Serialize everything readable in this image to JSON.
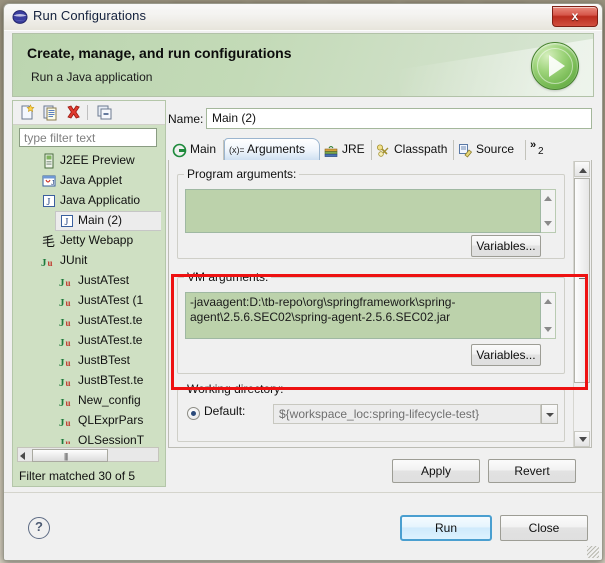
{
  "window": {
    "title": "Run Configurations",
    "title_icon": "eclipse-globe-icon",
    "close_label": "x"
  },
  "banner": {
    "title": "Create, manage, and run configurations",
    "subtitle": "Run a Java application",
    "badge_icon": "run-play-icon"
  },
  "sidebar": {
    "toolbar": [
      {
        "name": "new-configuration-icon",
        "label": "New launch configuration"
      },
      {
        "name": "duplicate-configuration-icon",
        "label": "Duplicate"
      },
      {
        "name": "delete-configuration-icon",
        "label": "Delete"
      },
      {
        "name": "collapse-all-icon",
        "label": "Collapse All"
      }
    ],
    "filter_placeholder": "type filter text",
    "filter_value": "",
    "tree": [
      {
        "label": "J2EE Preview",
        "icon": "j2ee-preview-icon",
        "indent": 1,
        "selected": false
      },
      {
        "label": "Java Applet",
        "icon": "java-applet-icon",
        "indent": 1,
        "selected": false
      },
      {
        "label": "Java Applicatio",
        "icon": "java-application-icon",
        "indent": 1,
        "selected": false
      },
      {
        "label": "Main (2)",
        "icon": "java-application-icon",
        "indent": 2,
        "selected": true
      },
      {
        "label": "Jetty Webapp",
        "icon": "jetty-webapp-icon",
        "indent": 1,
        "selected": false
      },
      {
        "label": "JUnit",
        "icon": "junit-icon",
        "indent": 1,
        "selected": false
      },
      {
        "label": "JustATest",
        "icon": "junit-icon",
        "indent": 2,
        "selected": false
      },
      {
        "label": "JustATest (1",
        "icon": "junit-icon",
        "indent": 2,
        "selected": false
      },
      {
        "label": "JustATest.te",
        "icon": "junit-icon",
        "indent": 2,
        "selected": false
      },
      {
        "label": "JustATest.te",
        "icon": "junit-icon",
        "indent": 2,
        "selected": false
      },
      {
        "label": "JustBTest",
        "icon": "junit-icon",
        "indent": 2,
        "selected": false
      },
      {
        "label": "JustBTest.te",
        "icon": "junit-icon",
        "indent": 2,
        "selected": false
      },
      {
        "label": "New_config",
        "icon": "junit-icon",
        "indent": 2,
        "selected": false
      },
      {
        "label": "QLExprPars",
        "icon": "junit-icon",
        "indent": 2,
        "selected": false
      },
      {
        "label": "QLSessionT",
        "icon": "junit-icon",
        "indent": 2,
        "selected": false
      }
    ],
    "filter_status": "Filter matched 30 of 5"
  },
  "main": {
    "name_label": "Name:",
    "name_value": "Main (2)",
    "tabs": [
      {
        "label": "Main",
        "icon": "main-tab-icon",
        "active": false
      },
      {
        "label": "Arguments",
        "icon": "arguments-tab-icon",
        "active": true
      },
      {
        "label": "JRE",
        "icon": "jre-tab-icon",
        "active": false
      },
      {
        "label": "Classpath",
        "icon": "classpath-tab-icon",
        "active": false
      },
      {
        "label": "Source",
        "icon": "source-tab-icon",
        "active": false
      }
    ],
    "tab_overflow_label": "2",
    "program_arguments": {
      "legend": "Program arguments:",
      "value": "",
      "variables_button": "Variables..."
    },
    "vm_arguments": {
      "legend": "VM arguments:",
      "value": "-javaagent:D:\\tb-repo\\org\\springframework\\spring-agent\\2.5.6.SEC02\\spring-agent-2.5.6.SEC02.jar",
      "variables_button": "Variables..."
    },
    "working_directory": {
      "legend": "Working directory:",
      "default_radio_label": "Default:",
      "default_selected": true,
      "path_value": "${workspace_loc:spring-lifecycle-test}"
    }
  },
  "footer": {
    "apply_label": "Apply",
    "revert_label": "Revert",
    "run_label": "Run",
    "close_label": "Close",
    "help_icon_label": "?"
  },
  "highlight": {
    "name": "vm-arguments-highlight",
    "color": "#ee1111"
  }
}
